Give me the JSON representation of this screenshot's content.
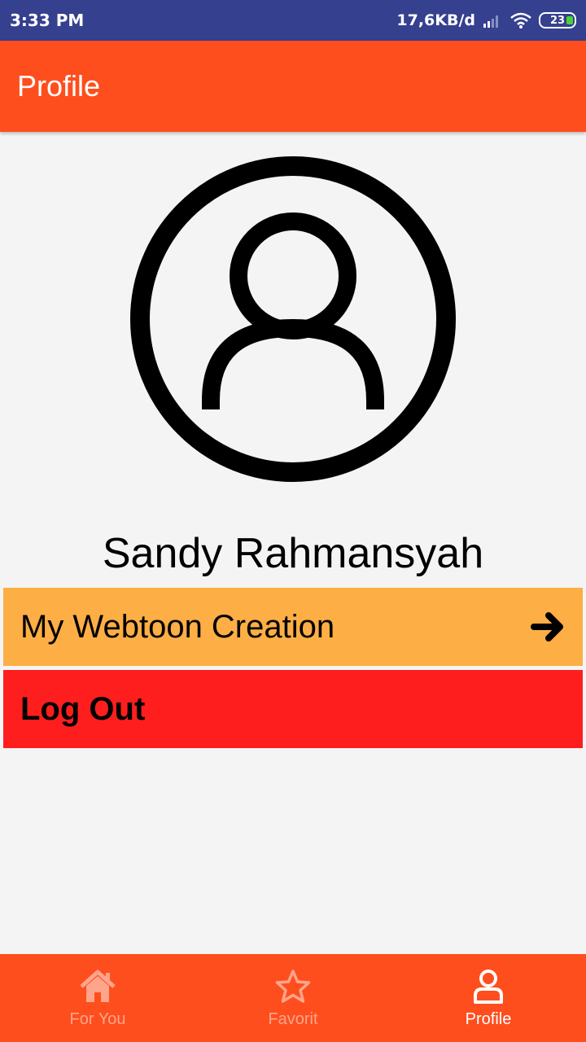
{
  "status_bar": {
    "time": "3:33 PM",
    "network_speed": "17,6KB/d",
    "battery_level": "23"
  },
  "app_bar": {
    "title": "Profile"
  },
  "profile": {
    "avatar_icon": "user-circle-icon",
    "name": "Sandy Rahmansyah"
  },
  "menu": {
    "webtoon_label": "My Webtoon Creation",
    "logout_label": "Log Out"
  },
  "bottom_nav": {
    "items": [
      {
        "label": "For You",
        "icon": "home-icon",
        "active": false
      },
      {
        "label": "Favorit",
        "icon": "star-icon",
        "active": false
      },
      {
        "label": "Profile",
        "icon": "user-icon",
        "active": true
      }
    ]
  },
  "colors": {
    "status_bar": "#35408f",
    "accent": "#fe4e1d",
    "webtoon_row": "#fdae45",
    "logout_row": "#ff1e1e"
  }
}
